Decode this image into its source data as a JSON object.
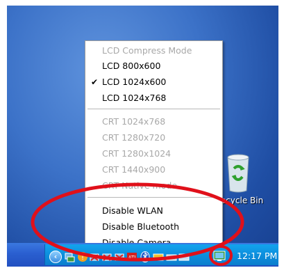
{
  "desktop": {
    "recycle_bin_label": "Recycle Bin"
  },
  "menu": {
    "items": [
      {
        "label": "LCD Compress Mode",
        "enabled": false,
        "checked": false
      },
      {
        "label": "LCD 800x600",
        "enabled": true,
        "checked": false
      },
      {
        "label": "LCD 1024x600",
        "enabled": true,
        "checked": true
      },
      {
        "label": "LCD 1024x768",
        "enabled": true,
        "checked": false
      },
      {
        "label": "CRT 1024x768",
        "enabled": false,
        "checked": false
      },
      {
        "label": "CRT 1280x720",
        "enabled": false,
        "checked": false
      },
      {
        "label": "CRT 1280x1024",
        "enabled": false,
        "checked": false
      },
      {
        "label": "CRT 1440x900",
        "enabled": false,
        "checked": false
      },
      {
        "label": "CRT Native mode",
        "enabled": false,
        "checked": false
      },
      {
        "label": "Disable WLAN",
        "enabled": true,
        "checked": false
      },
      {
        "label": "Disable Bluetooth",
        "enabled": true,
        "checked": false
      },
      {
        "label": "Disable Camera",
        "enabled": true,
        "checked": false
      }
    ]
  },
  "taskbar": {
    "clock": "12:17 PM",
    "tray_icons": [
      "show-hidden-icons",
      "network-icon",
      "warning-icon",
      "disconnected-network-icon",
      "disconnected-network-icon",
      "ati-icon",
      "bluetooth-icon",
      "device-icon",
      "device-icon",
      "display-utility-icon"
    ]
  },
  "annotation": {
    "color": "#e0101a"
  }
}
